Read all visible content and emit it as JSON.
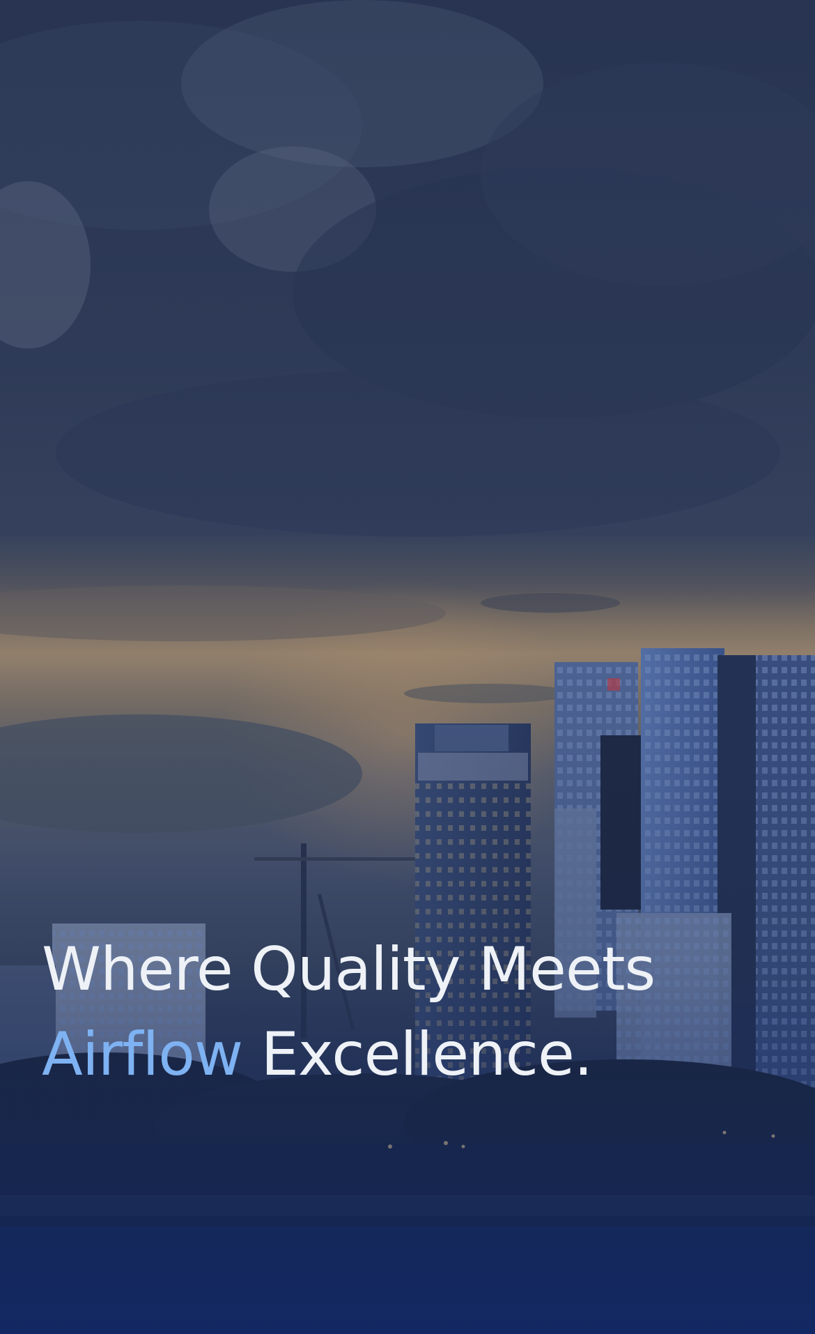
{
  "hero": {
    "headline_line1": "Where Quality Meets",
    "headline_accent": "Airflow",
    "headline_rest": "Excellence.",
    "accent_color": "#7eb2f2",
    "text_color": "#eef2f7"
  }
}
